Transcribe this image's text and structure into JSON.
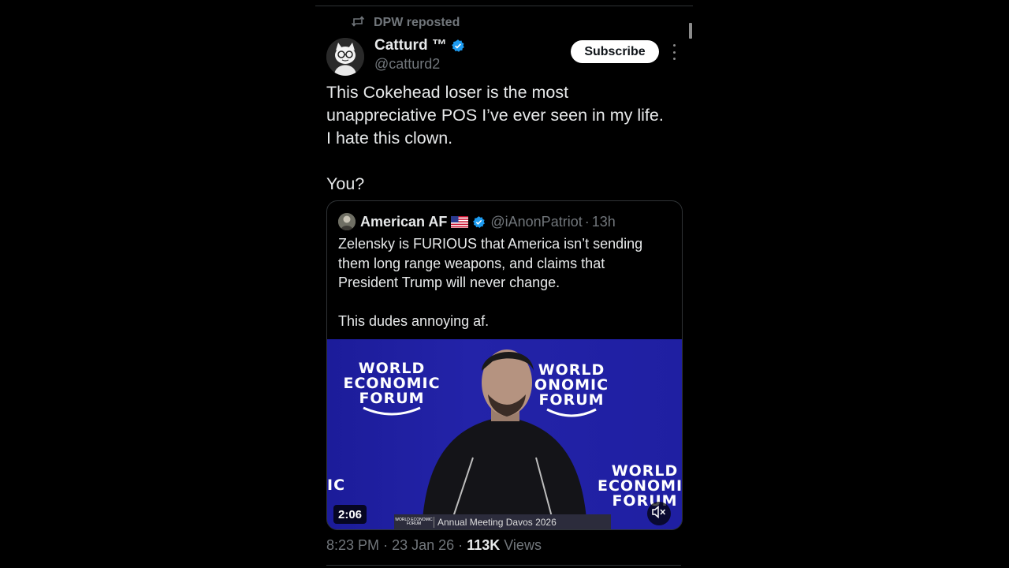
{
  "repost": {
    "label": "DPW reposted",
    "icon": "repost-icon"
  },
  "author": {
    "name": "Catturd ™",
    "handle": "@catturd2",
    "verified": true,
    "verified_color": "#1d9bf0"
  },
  "actions": {
    "subscribe_label": "Subscribe",
    "more_icon": "more-vertical-icon"
  },
  "tweet": {
    "lines": [
      "This Cokehead loser is the most",
      "unappreciative POS I’ve ever seen in my life.",
      "I hate this clown.",
      "You?"
    ]
  },
  "quote": {
    "name": "American AF",
    "flag": "🇺🇸",
    "handle": "@iAnonPatriot",
    "separator": "·",
    "time": "13h",
    "lines": [
      "Zelensky is FURIOUS that America isn’t sending",
      "them long range weapons, and claims that",
      "President Trump will never change.",
      "This dudes annoying af."
    ],
    "video": {
      "duration": "2:06",
      "background_color": "#1f1fa0",
      "logo_lines": [
        "WORLD",
        "ECONOMIC",
        "FORUM"
      ],
      "logo_right_lines": [
        "WORLD",
        "ECONOMIC",
        "FORUM"
      ],
      "logo_center_lines": [
        "WORLD",
        "ONOMIC",
        "FORUM"
      ],
      "left_fragment": "IC",
      "podium_small": "WORLD ECONOMIC FORUM",
      "podium_text": "Annual Meeting Davos 2026",
      "mute_icon": "muted-speaker-icon"
    }
  },
  "meta": {
    "time": "8:23 PM",
    "separator": "·",
    "date": "23 Jan 26",
    "views_count": "113K",
    "views_label": "Views"
  }
}
